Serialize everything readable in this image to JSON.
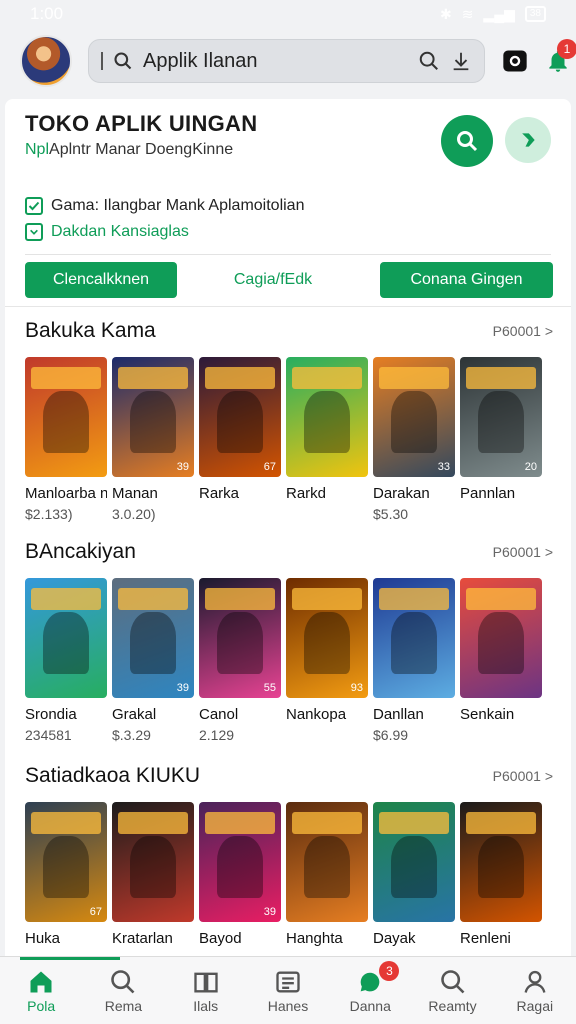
{
  "status": {
    "time": "1:00",
    "battery": "38"
  },
  "header": {
    "search_value": "Applik Ilanan",
    "notif_count": "1"
  },
  "panel": {
    "title": "TOKO APLIK UINGAN",
    "subtitle_prefix": "Npl",
    "subtitle_rest": "Aplntr Manar DoengKinne",
    "check1": "Gama: Ilangbar Mank Aplamoitolian",
    "check2": "Dakdan Kansiaglas",
    "btn1": "Clencalkknen",
    "btn2": "Cagia/fEdk",
    "btn3": "Conana Gingen"
  },
  "sections": [
    {
      "title": "Bakuka Kama",
      "more": "P60001 >",
      "cards": [
        {
          "name": "Manloarba n",
          "price": "$2.133)",
          "num": "",
          "c1": "#c0392b",
          "c2": "#f39c12"
        },
        {
          "name": "Manan",
          "price": "3.0.20)",
          "num": "39",
          "c1": "#1b2a6b",
          "c2": "#e67e22"
        },
        {
          "name": "Rarka",
          "price": "",
          "num": "67",
          "c1": "#2c1a3a",
          "c2": "#d35400"
        },
        {
          "name": "Rarkd",
          "price": "",
          "num": "",
          "c1": "#27ae60",
          "c2": "#f1c40f"
        },
        {
          "name": "Darakan",
          "price": "$5.30",
          "num": "33",
          "c1": "#e67e22",
          "c2": "#34495e"
        },
        {
          "name": "Pannlan",
          "price": "",
          "num": "20",
          "c1": "#2d3436",
          "c2": "#7f8c8d"
        }
      ]
    },
    {
      "title": "BAncakiyan",
      "more": "P60001 >",
      "cards": [
        {
          "name": "Srondia",
          "price": "234581",
          "num": "",
          "c1": "#3498db",
          "c2": "#27ae60"
        },
        {
          "name": "Grakal",
          "price": "$.3.29",
          "num": "39",
          "c1": "#5d6d7e",
          "c2": "#2e86c1"
        },
        {
          "name": "Canol",
          "price": "2.129",
          "num": "55",
          "c1": "#1a1a2e",
          "c2": "#e84393"
        },
        {
          "name": "Nankopa",
          "price": "",
          "num": "93",
          "c1": "#6e2c00",
          "c2": "#f39c12"
        },
        {
          "name": "Danllan",
          "price": "$6.99",
          "num": "",
          "c1": "#1f3a93",
          "c2": "#5dade2"
        },
        {
          "name": "Senkain",
          "price": "",
          "num": "",
          "c1": "#e74c3c",
          "c2": "#6c3483"
        }
      ]
    },
    {
      "title": "Satiadkaoa KIUKU",
      "more": "P60001 >",
      "cards": [
        {
          "name": "Huka",
          "price": "",
          "num": "67",
          "c1": "#2e4053",
          "c2": "#d68910"
        },
        {
          "name": "Kratarlan",
          "price": "",
          "num": "",
          "c1": "#1c1c1c",
          "c2": "#c0392b"
        },
        {
          "name": "Bayod",
          "price": "",
          "num": "39",
          "c1": "#4a235a",
          "c2": "#e91e63"
        },
        {
          "name": "Hanghta",
          "price": "",
          "num": "",
          "c1": "#5b2c0f",
          "c2": "#e67e22"
        },
        {
          "name": "Dayak",
          "price": "",
          "num": "",
          "c1": "#1e8449",
          "c2": "#2874a6"
        },
        {
          "name": "Renleni",
          "price": "",
          "num": "",
          "c1": "#1b1b1b",
          "c2": "#d35400"
        }
      ]
    }
  ],
  "nav": [
    {
      "label": "Pola",
      "icon": "home-icon",
      "active": true
    },
    {
      "label": "Rema",
      "icon": "search-icon"
    },
    {
      "label": "Ilals",
      "icon": "books-icon"
    },
    {
      "label": "Hanes",
      "icon": "list-icon"
    },
    {
      "label": "Danna",
      "icon": "notification-icon",
      "badge": "3"
    },
    {
      "label": "Reamty",
      "icon": "search-icon"
    },
    {
      "label": "Ragai",
      "icon": "person-icon"
    }
  ],
  "colors": {
    "accent": "#0f9d58"
  }
}
